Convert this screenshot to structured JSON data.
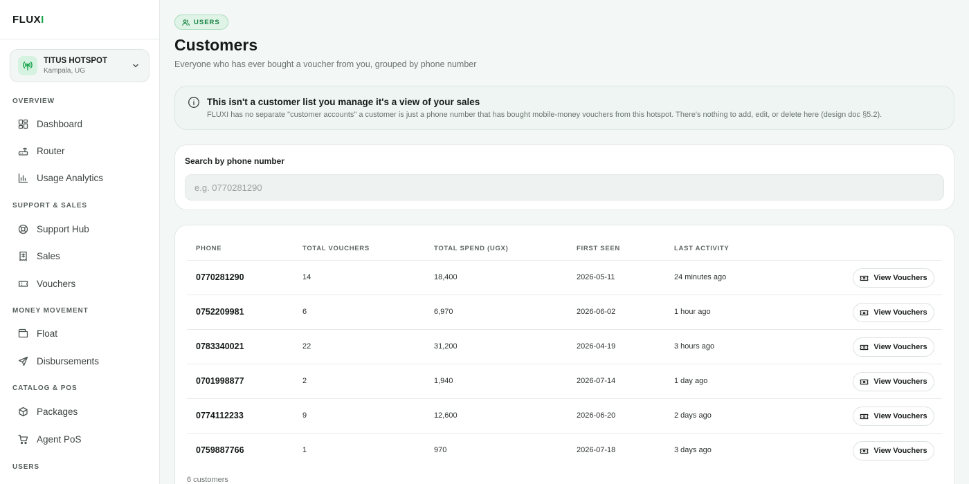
{
  "brand": {
    "name": "FLUX",
    "accent_letter": "I",
    "accent_color": "#16a34a"
  },
  "hotspot": {
    "name": "TITUS HOTSPOT",
    "location": "Kampala, UG"
  },
  "sidebar": {
    "sections": [
      {
        "title": "OVERVIEW",
        "items": [
          {
            "label": "Dashboard",
            "icon": "dashboard-icon"
          },
          {
            "label": "Router",
            "icon": "router-icon"
          },
          {
            "label": "Usage Analytics",
            "icon": "analytics-icon"
          }
        ]
      },
      {
        "title": "SUPPORT & SALES",
        "items": [
          {
            "label": "Support Hub",
            "icon": "lifebuoy-icon"
          },
          {
            "label": "Sales",
            "icon": "receipt-icon"
          },
          {
            "label": "Vouchers",
            "icon": "ticket-icon"
          }
        ]
      },
      {
        "title": "MONEY MOVEMENT",
        "items": [
          {
            "label": "Float",
            "icon": "wallet-icon"
          },
          {
            "label": "Disbursements",
            "icon": "send-icon"
          }
        ]
      },
      {
        "title": "CATALOG & POS",
        "items": [
          {
            "label": "Packages",
            "icon": "package-icon"
          },
          {
            "label": "Agent PoS",
            "icon": "cart-icon"
          }
        ]
      },
      {
        "title": "USERS",
        "items": []
      }
    ]
  },
  "page": {
    "badge": "USERS",
    "title": "Customers",
    "subtitle": "Everyone who has ever bought a voucher from you, grouped by phone number"
  },
  "info": {
    "title": "This isn't a customer list you manage it's a view of your sales",
    "text": "FLUXI has no separate \"customer accounts\" a customer is just a phone number that has bought mobile-money vouchers from this hotspot. There's nothing to add, edit, or delete here (design doc §5.2)."
  },
  "search": {
    "label": "Search by phone number",
    "placeholder": "e.g. 0770281290",
    "value": ""
  },
  "table": {
    "columns": [
      "PHONE",
      "TOTAL VOUCHERS",
      "TOTAL SPEND (UGX)",
      "FIRST SEEN",
      "LAST ACTIVITY"
    ],
    "action_label": "View Vouchers",
    "rows": [
      {
        "phone": "0770281290",
        "vouchers": "14",
        "spend": "18,400",
        "first_seen": "2026-05-11",
        "last_activity": "24 minutes ago"
      },
      {
        "phone": "0752209981",
        "vouchers": "6",
        "spend": "6,970",
        "first_seen": "2026-06-02",
        "last_activity": "1 hour ago"
      },
      {
        "phone": "0783340021",
        "vouchers": "22",
        "spend": "31,200",
        "first_seen": "2026-04-19",
        "last_activity": "3 hours ago"
      },
      {
        "phone": "0701998877",
        "vouchers": "2",
        "spend": "1,940",
        "first_seen": "2026-07-14",
        "last_activity": "1 day ago"
      },
      {
        "phone": "0774112233",
        "vouchers": "9",
        "spend": "12,600",
        "first_seen": "2026-06-20",
        "last_activity": "2 days ago"
      },
      {
        "phone": "0759887766",
        "vouchers": "1",
        "spend": "970",
        "first_seen": "2026-07-18",
        "last_activity": "3 days ago"
      }
    ],
    "footer": "6 customers"
  }
}
